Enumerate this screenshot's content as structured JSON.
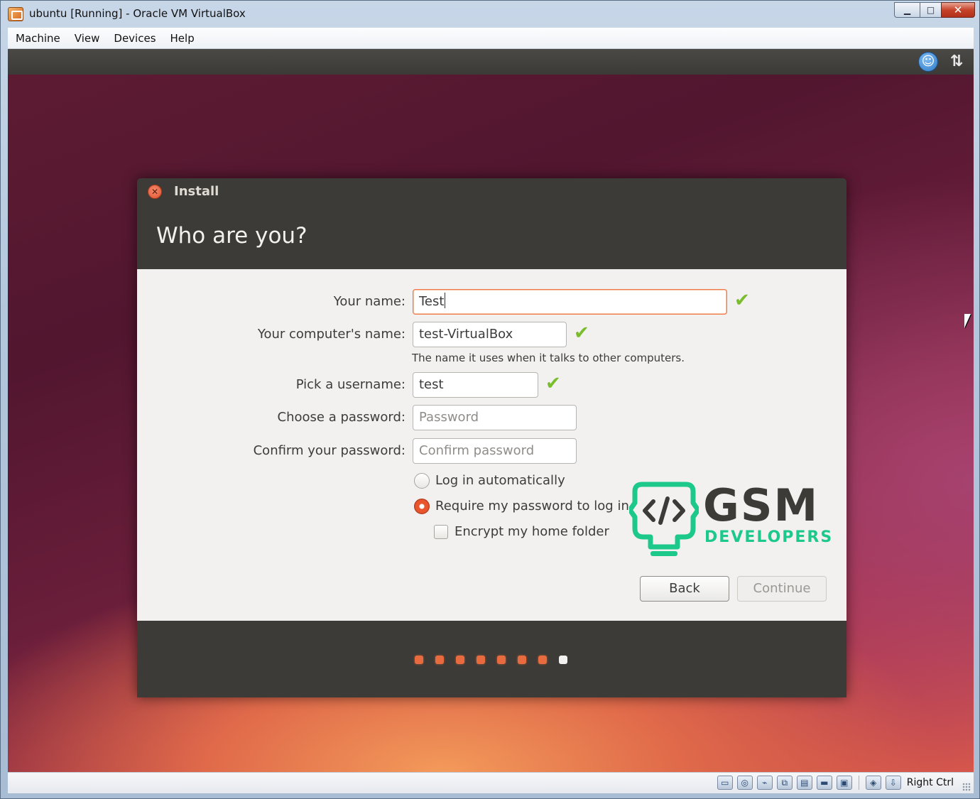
{
  "window": {
    "title": "ubuntu [Running] - Oracle VM VirtualBox",
    "controls": {
      "minimize": "▁",
      "maximize": "□",
      "close": "✕"
    }
  },
  "menubar": {
    "items": [
      {
        "label": "Machine"
      },
      {
        "label": "View"
      },
      {
        "label": "Devices"
      },
      {
        "label": "Help"
      }
    ]
  },
  "guest_topbar": {
    "icons": [
      "accessibility-icon",
      "network-arrows-icon"
    ]
  },
  "dialog": {
    "title": "Install",
    "heading": "Who are you?",
    "fields": {
      "your_name": {
        "label": "Your name:",
        "value": "Test",
        "valid": true
      },
      "computer_name": {
        "label": "Your computer's name:",
        "value": "test-VirtualBox",
        "valid": true,
        "hint": "The name it uses when it talks to other computers."
      },
      "username": {
        "label": "Pick a username:",
        "value": "test",
        "valid": true
      },
      "password": {
        "label": "Choose a password:",
        "value": "",
        "placeholder": "Password"
      },
      "confirm_password": {
        "label": "Confirm your password:",
        "value": "",
        "placeholder": "Confirm password"
      }
    },
    "login_options": {
      "auto_login": {
        "label": "Log in automatically",
        "selected": false
      },
      "require_password": {
        "label": "Require my password to log in",
        "selected": true
      },
      "encrypt_home": {
        "label": "Encrypt my home folder",
        "checked": false
      }
    },
    "buttons": {
      "back": "Back",
      "continue": "Continue"
    },
    "progress": {
      "total_steps": 8,
      "current_step": 8
    }
  },
  "watermark": {
    "brand": "GSM",
    "tagline": "DEVELOPERS"
  },
  "statusbar": {
    "icons": [
      "hard-disk-icon",
      "optical-drive-icon",
      "usb-icon",
      "network-icon",
      "shared-folders-icon",
      "display-icon",
      "video-capture-icon",
      "mouse-integration-icon",
      "host-key-icon"
    ],
    "host_key": "Right Ctrl"
  },
  "colors": {
    "accent": "#e9552c",
    "valid_check": "#79bc2c",
    "dialog_header": "#3c3b37",
    "dialog_body": "#f2f1f0",
    "watermark_green": "#1cc98a"
  }
}
